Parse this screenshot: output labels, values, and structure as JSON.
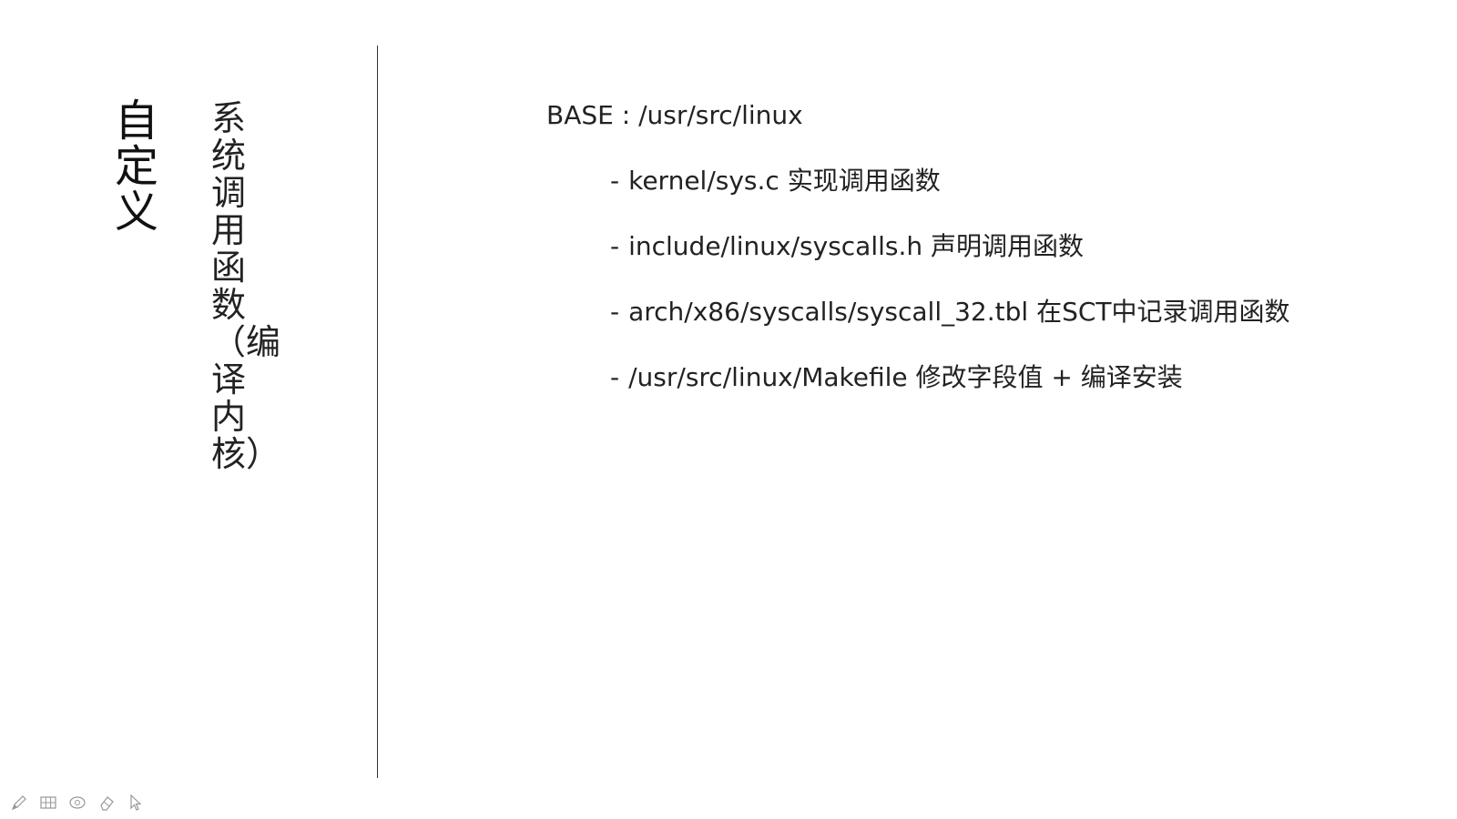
{
  "slide": {
    "title_main": "自定义",
    "title_sub": "系统调用函数（编译内核）",
    "base": "BASE : /usr/src/linux",
    "items": [
      {
        "dash": "-",
        "path": "kernel/sys.c",
        "desc": "实现调用函数"
      },
      {
        "dash": "-",
        "path": "include/linux/syscalls.h",
        "desc": "声明调用函数"
      },
      {
        "dash": "-",
        "path": "arch/x86/syscalls/syscall_32.tbl",
        "desc": "在SCT中记录调用函数"
      },
      {
        "dash": "-",
        "path": "/usr/src/linux/Makefile",
        "desc": "修改字段值 + 编译安装"
      }
    ]
  },
  "toolbar": {
    "tools": [
      "pen-icon",
      "slides-grid-icon",
      "zoom-icon",
      "eraser-icon",
      "pointer-icon"
    ]
  }
}
